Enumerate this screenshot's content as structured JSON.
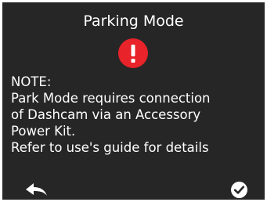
{
  "dialog": {
    "title": "Parking Mode",
    "alert_icon": "exclamation-circle-icon",
    "alert_color": "#e8232a",
    "background_color": "#262626",
    "message_lines": [
      "NOTE:",
      "Park Mode requires connection",
      "of Dashcam via an Accessory",
      "Power Kit.",
      "Refer to use's guide for details"
    ]
  },
  "footer": {
    "back_icon": "back-arrow-icon",
    "confirm_icon": "checkmark-circle-icon"
  }
}
